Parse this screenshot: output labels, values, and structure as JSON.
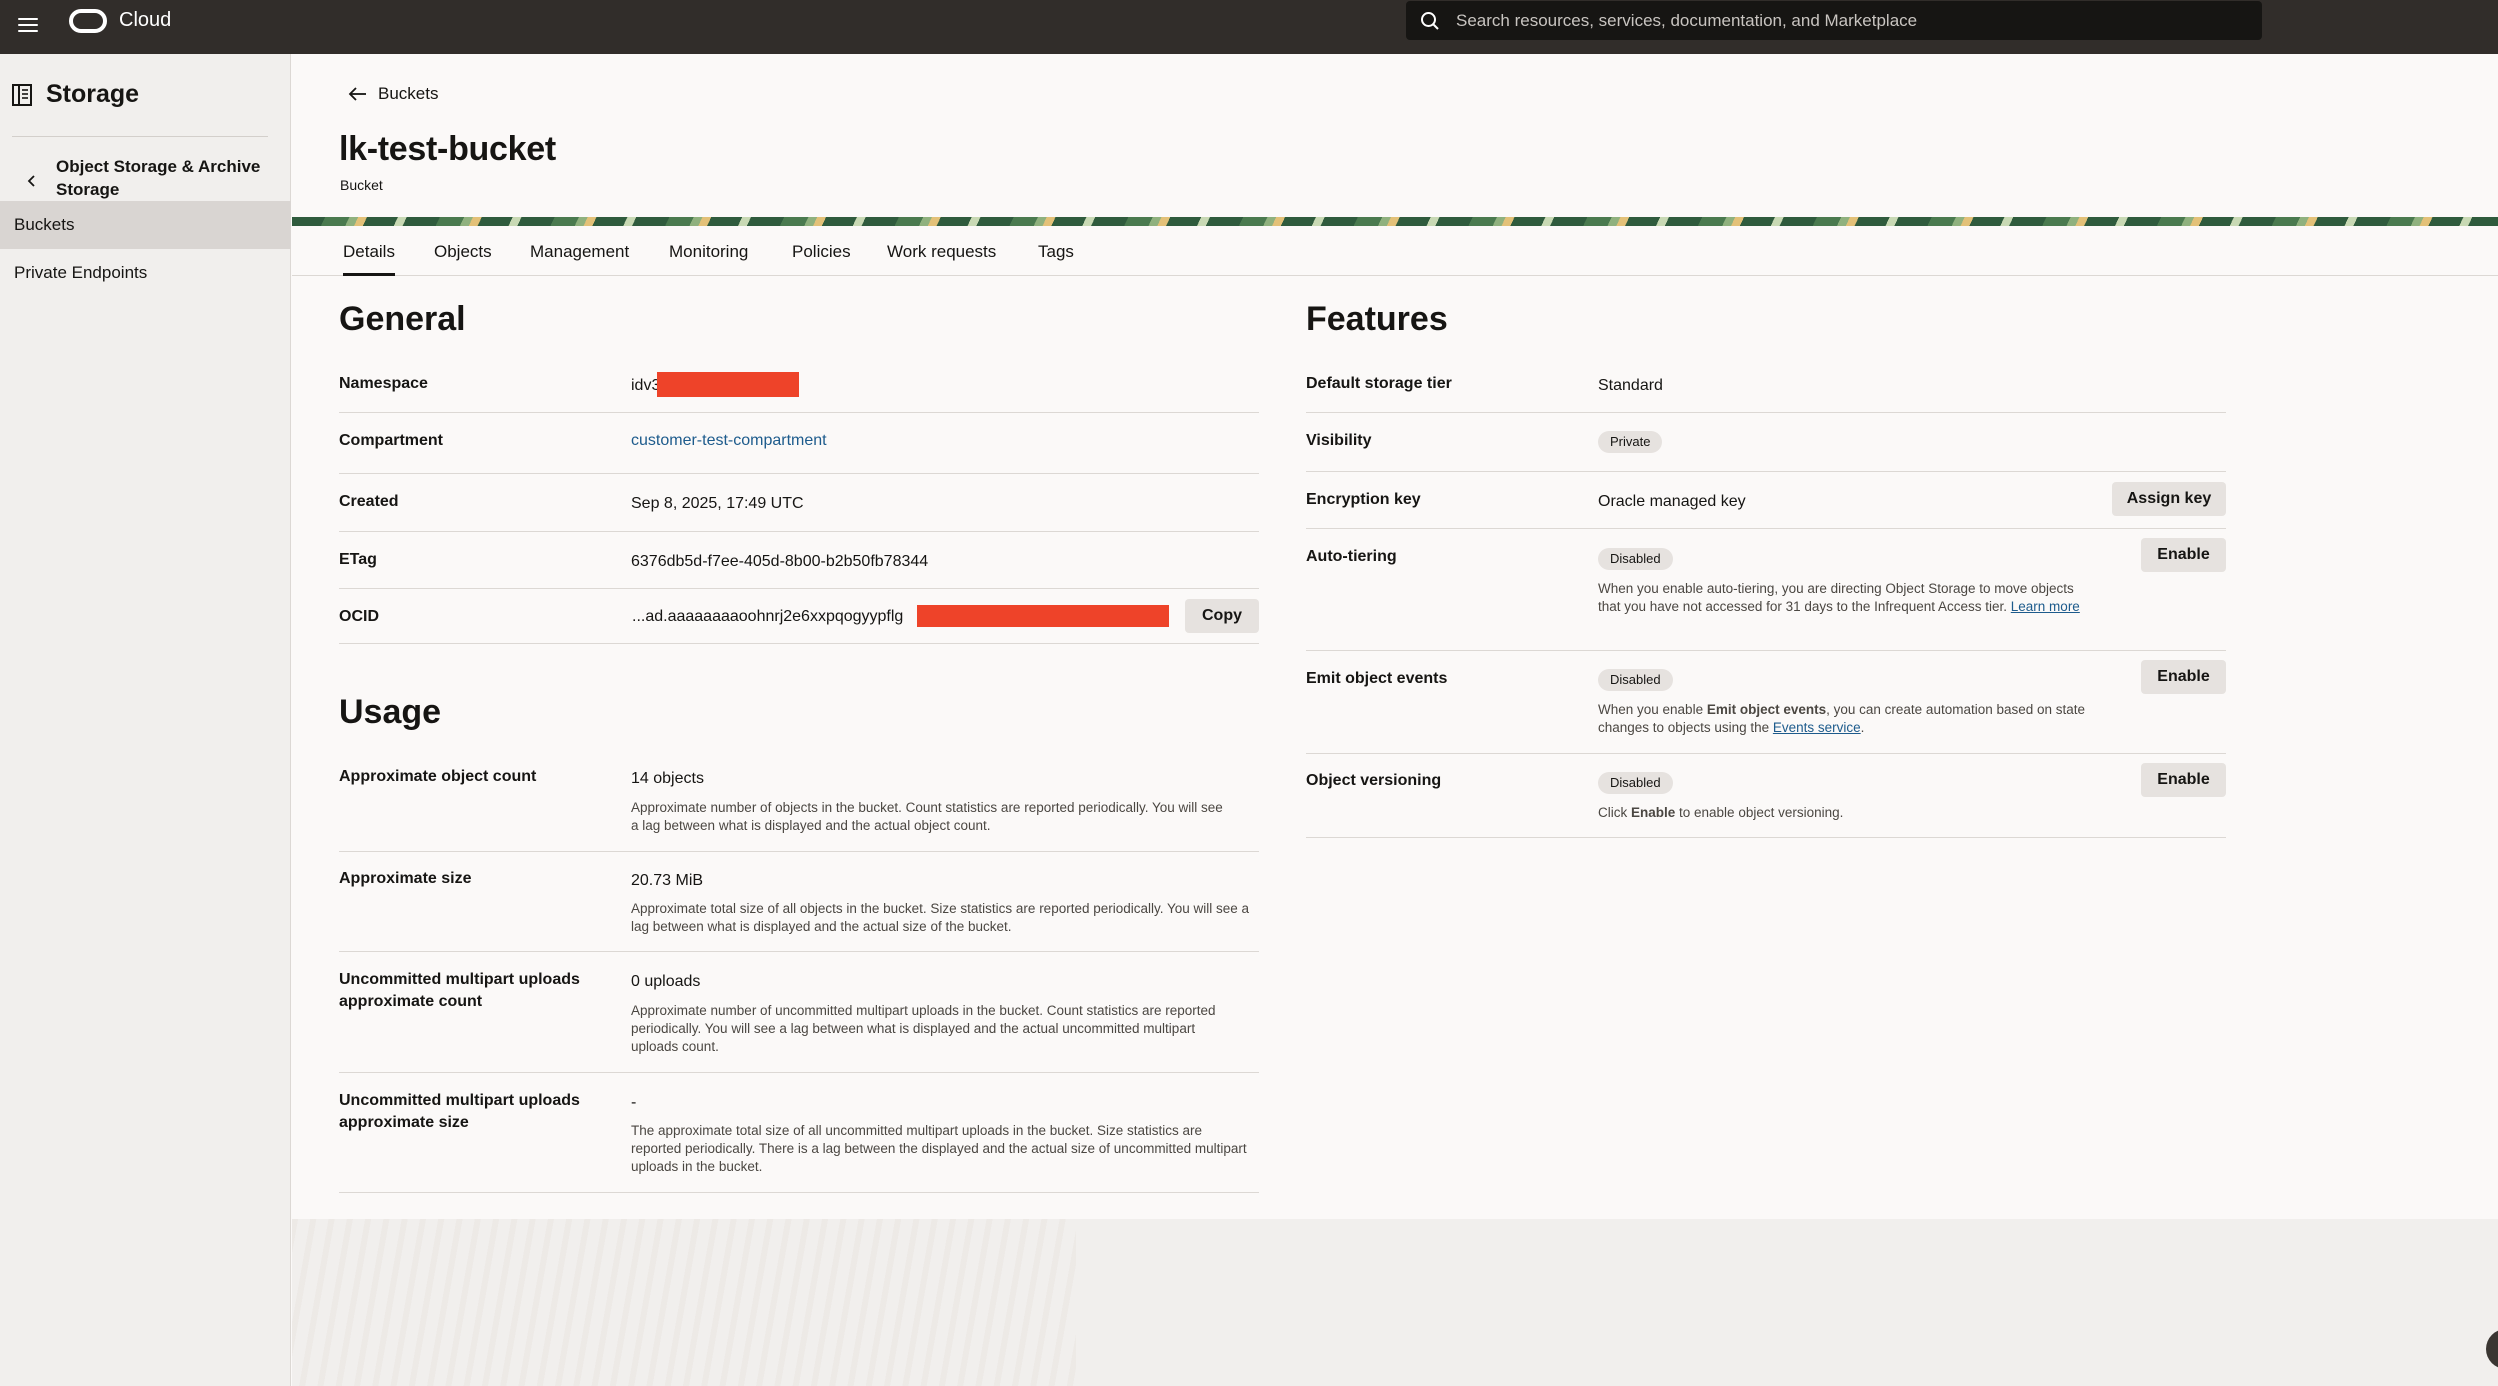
{
  "topbar": {
    "brand": "Cloud",
    "search_placeholder": "Search resources, services, documentation, and Marketplace"
  },
  "sidebar": {
    "title": "Storage",
    "parent": "Object Storage & Archive Storage",
    "items": [
      {
        "label": "Buckets",
        "active": true
      },
      {
        "label": "Private Endpoints",
        "active": false
      }
    ]
  },
  "header": {
    "back_label": "Buckets",
    "title": "lk-test-bucket",
    "subtitle": "Bucket"
  },
  "tabs": [
    "Details",
    "Objects",
    "Management",
    "Monitoring",
    "Policies",
    "Work requests",
    "Tags"
  ],
  "general": {
    "title": "General",
    "namespace": {
      "label": "Namespace",
      "value": "idv3"
    },
    "compartment": {
      "label": "Compartment",
      "value": "customer-test-compartment"
    },
    "created": {
      "label": "Created",
      "value": "Sep 8, 2025, 17:49 UTC"
    },
    "etag": {
      "label": "ETag",
      "value": "6376db5d-f7ee-405d-8b00-b2b50fb78344"
    },
    "ocid": {
      "label": "OCID",
      "value": "...ad.aaaaaaaaoohnrj2e6xxpqogyypflg",
      "copy_label": "Copy"
    }
  },
  "usage": {
    "title": "Usage",
    "rows": [
      {
        "label": "Approximate object count",
        "value": "14 objects",
        "help": "Approximate number of objects in the bucket. Count statistics are reported periodically. You will see a lag between what is displayed and the actual object count."
      },
      {
        "label": "Approximate size",
        "value": "20.73 MiB",
        "help": "Approximate total size of all objects in the bucket. Size statistics are reported periodically. You will see a lag between what is displayed and the actual size of the bucket."
      },
      {
        "label": "Uncommitted multipart uploads approximate count",
        "value": "0 uploads",
        "help": "Approximate number of uncommitted multipart uploads in the bucket. Count statistics are reported periodically. You will see a lag between what is displayed and the actual uncommitted multipart uploads count."
      },
      {
        "label": "Uncommitted multipart uploads approximate size",
        "value": "-",
        "help": "The approximate total size of all uncommitted multipart uploads in the bucket. Size statistics are reported periodically. There is a lag between the displayed and the actual size of uncommitted multipart uploads in the bucket."
      }
    ]
  },
  "features": {
    "title": "Features",
    "storage_tier": {
      "label": "Default storage tier",
      "value": "Standard"
    },
    "visibility": {
      "label": "Visibility",
      "value": "Private"
    },
    "encryption": {
      "label": "Encryption key",
      "value": "Oracle managed key",
      "button": "Assign key"
    },
    "auto_tiering": {
      "label": "Auto-tiering",
      "status": "Disabled",
      "button": "Enable",
      "help": "When you enable auto-tiering, you are directing Object Storage to move objects that you have not accessed for 31 days to the Infrequent Access tier.",
      "link": "Learn more"
    },
    "object_events": {
      "label": "Emit object events",
      "status": "Disabled",
      "button": "Enable",
      "help_pre": "When you enable ",
      "help_bold": "Emit object events",
      "help_mid": ", you can create automation based on state changes to objects using the ",
      "link": "Events service",
      "help_post": "."
    },
    "versioning": {
      "label": "Object versioning",
      "status": "Disabled",
      "button": "Enable",
      "help_pre": "Click ",
      "help_bold": "Enable",
      "help_post": " to enable object versioning."
    }
  },
  "colors": {
    "topbar": "#312d2a",
    "link": "#1d5b8c",
    "redaction": "#ee4329",
    "sidebar": "#f1efed"
  }
}
